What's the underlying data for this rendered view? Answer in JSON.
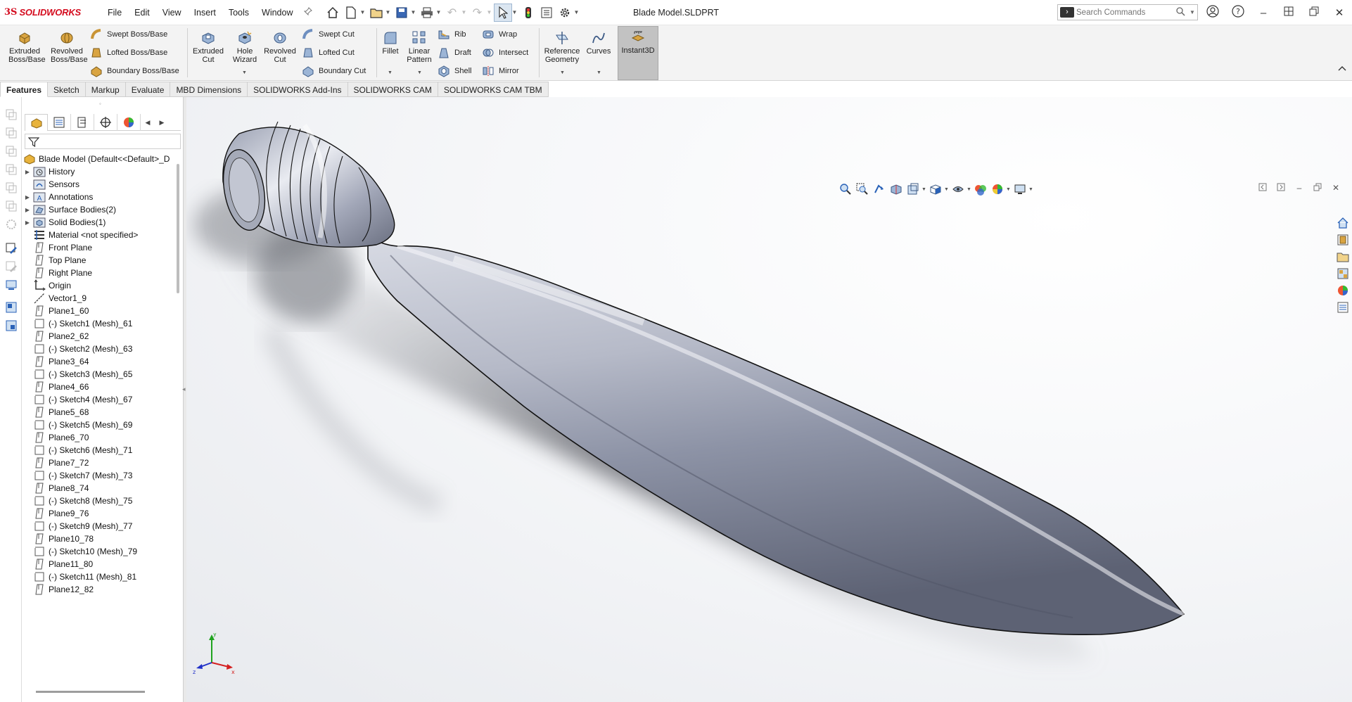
{
  "app": {
    "logo_ds": "3S",
    "logo_name": "SOLIDWORKS",
    "document_title": "Blade Model.SLDPRT",
    "brand_color": "#d40b1e"
  },
  "menu": [
    "File",
    "Edit",
    "View",
    "Insert",
    "Tools",
    "Window"
  ],
  "search": {
    "placeholder": "Search Commands"
  },
  "commands": {
    "extruded_boss": "Extruded Boss/Base",
    "revolved_boss": "Revolved Boss/Base",
    "swept_boss": "Swept Boss/Base",
    "lofted_boss": "Lofted Boss/Base",
    "boundary_boss": "Boundary Boss/Base",
    "extruded_cut": "Extruded Cut",
    "hole_wizard": "Hole Wizard",
    "revolved_cut": "Revolved Cut",
    "swept_cut": "Swept Cut",
    "lofted_cut": "Lofted Cut",
    "boundary_cut": "Boundary Cut",
    "fillet": "Fillet",
    "linear_pattern": "Linear Pattern",
    "rib": "Rib",
    "draft": "Draft",
    "shell": "Shell",
    "wrap": "Wrap",
    "intersect": "Intersect",
    "mirror": "Mirror",
    "reference_geometry": "Reference Geometry",
    "curves": "Curves",
    "instant3d": "Instant3D"
  },
  "tabs": [
    "Features",
    "Sketch",
    "Markup",
    "Evaluate",
    "MBD Dimensions",
    "SOLIDWORKS Add-Ins",
    "SOLIDWORKS CAM",
    "SOLIDWORKS CAM TBM"
  ],
  "active_tab": "Features",
  "tree": {
    "root": "Blade Model  (Default<<Default>_D",
    "items": [
      "History",
      "Sensors",
      "Annotations",
      "Surface Bodies(2)",
      "Solid Bodies(1)",
      "Material <not specified>",
      "Front Plane",
      "Top Plane",
      "Right Plane",
      "Origin",
      "Vector1_9",
      "Plane1_60",
      "(-) Sketch1 (Mesh)_61",
      "Plane2_62",
      "(-) Sketch2 (Mesh)_63",
      "Plane3_64",
      "(-) Sketch3 (Mesh)_65",
      "Plane4_66",
      "(-) Sketch4 (Mesh)_67",
      "Plane5_68",
      "(-) Sketch5 (Mesh)_69",
      "Plane6_70",
      "(-) Sketch6 (Mesh)_71",
      "Plane7_72",
      "(-) Sketch7 (Mesh)_73",
      "Plane8_74",
      "(-) Sketch8 (Mesh)_75",
      "Plane9_76",
      "(-) Sketch9 (Mesh)_77",
      "Plane10_78",
      "(-) Sketch10 (Mesh)_79",
      "Plane11_80",
      "(-) Sketch11 (Mesh)_81",
      "Plane12_82"
    ]
  },
  "triad": {
    "x": "x",
    "y": "y",
    "z": "z"
  },
  "colors": {
    "ribbon_bg": "#f3f3f3",
    "instant3d_active": "#c2c2c2",
    "blade_base": "#8d93a6",
    "axis_x": "#d42020",
    "axis_y": "#1fa31f",
    "axis_z": "#2030c8"
  }
}
